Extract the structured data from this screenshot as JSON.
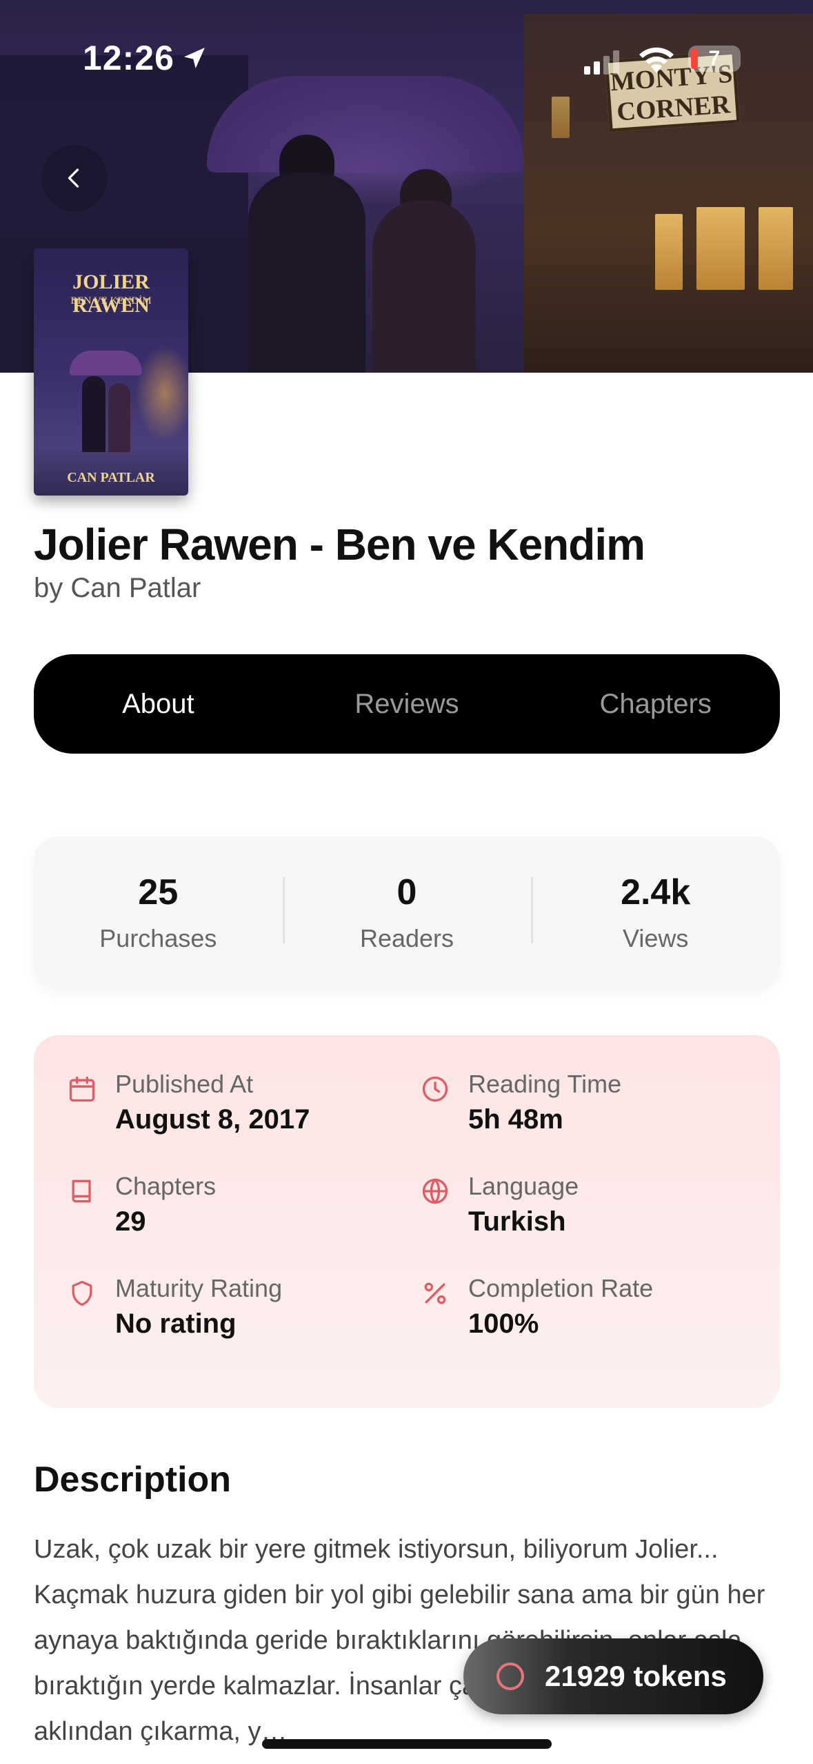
{
  "status_bar": {
    "time": "12:26",
    "battery": "7"
  },
  "hero": {
    "sign_text": "MONTY'S CORNER"
  },
  "cover": {
    "title": "JOLIER RAWEN",
    "subtitle": "BEN VE KENDİM",
    "author": "CAN PATLAR"
  },
  "book": {
    "title": "Jolier Rawen - Ben ve Kendim",
    "byline": "by Can Patlar"
  },
  "tabs": [
    {
      "label": "About",
      "active": true
    },
    {
      "label": "Reviews",
      "active": false
    },
    {
      "label": "Chapters",
      "active": false
    }
  ],
  "stats": [
    {
      "value": "25",
      "label": "Purchases"
    },
    {
      "value": "0",
      "label": "Readers"
    },
    {
      "value": "2.4k",
      "label": "Views"
    }
  ],
  "info": [
    {
      "icon": "calendar-icon",
      "label": "Published At",
      "value": "August 8, 2017"
    },
    {
      "icon": "clock-icon",
      "label": "Reading Time",
      "value": "5h 48m"
    },
    {
      "icon": "book-icon",
      "label": "Chapters",
      "value": "29"
    },
    {
      "icon": "globe-icon",
      "label": "Language",
      "value": "Turkish"
    },
    {
      "icon": "shield-icon",
      "label": "Maturity Rating",
      "value": "No rating"
    },
    {
      "icon": "percent-icon",
      "label": "Completion Rate",
      "value": "100%"
    }
  ],
  "description": {
    "title": "Description",
    "text": "Uzak, çok uzak bir yere gitmek istiyorsun, biliyorum Jolier... Kaçmak huzura giden bir yol gibi gelebilir sana ama bir gün her aynaya baktığında geride bıraktıklarını görebilirsin, onlar asla bıraktığın yerde kalmazlar. İnsanlar çabuk değişir Jolier, bunu aklından çıkarma, y…"
  },
  "tokens": {
    "label": "21929 tokens"
  },
  "colors": {
    "accent": "#e25b63",
    "info_bg": "#fde4e4",
    "tabs_bg": "#000000"
  }
}
